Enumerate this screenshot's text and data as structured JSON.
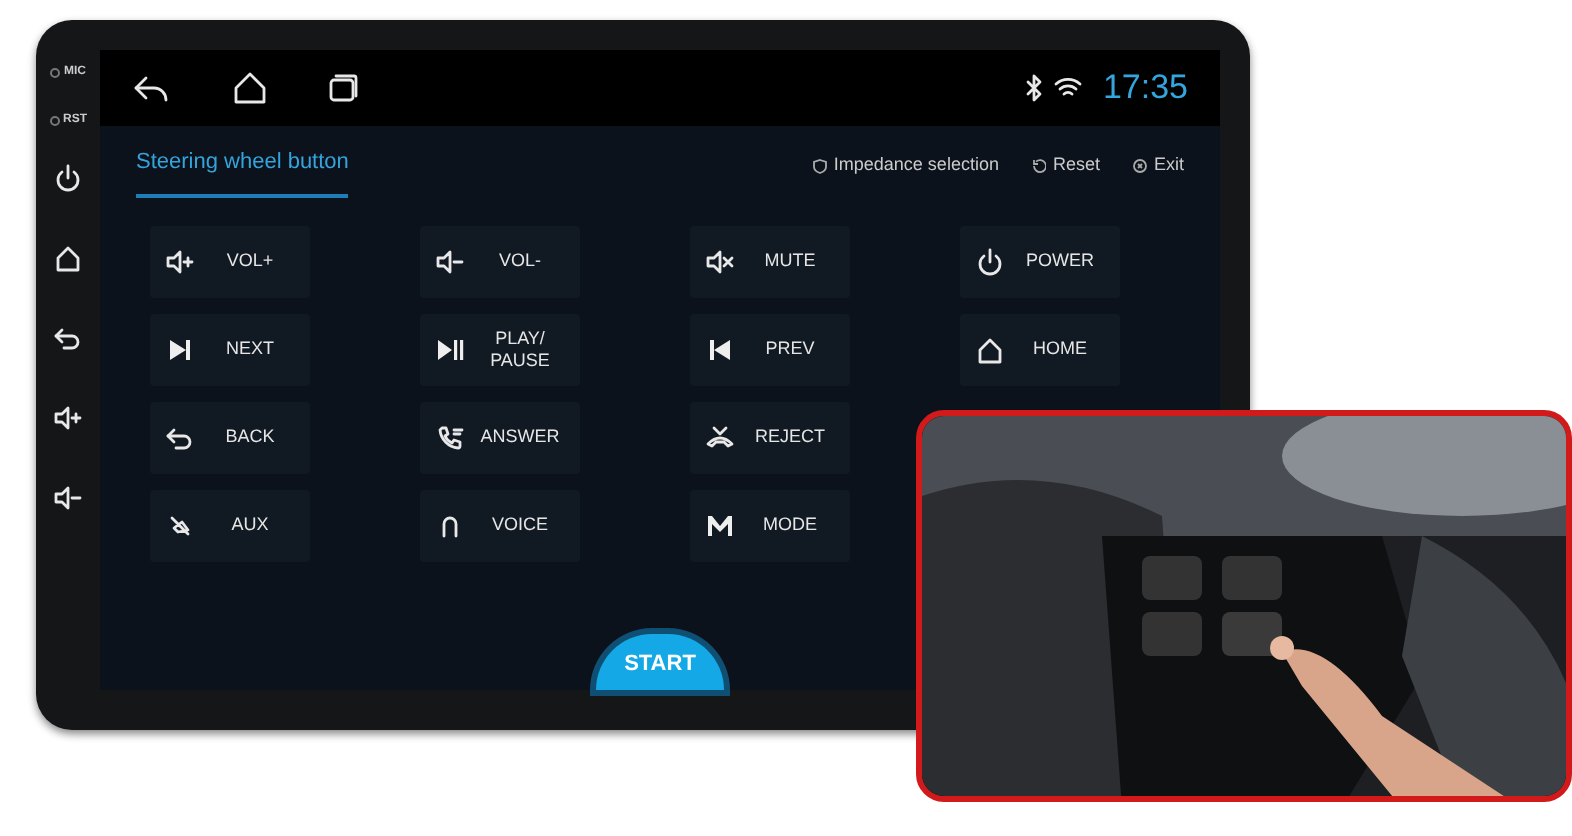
{
  "side_panel": {
    "labels": [
      "MIC",
      "RST"
    ]
  },
  "status_bar": {
    "time": "17:35"
  },
  "tab": {
    "label": "Steering wheel button",
    "selected": true
  },
  "actions": [
    "Impedance selection",
    "Reset",
    "Exit"
  ],
  "button_rows": [
    [
      {
        "label": "VOL+"
      },
      {
        "label": "VOL-"
      },
      {
        "label": "MUTE"
      },
      {
        "label": "POWER"
      }
    ],
    [
      {
        "label": "NEXT"
      },
      {
        "label": "PLAY/\nPAUSE"
      },
      {
        "label": "PREV"
      },
      {
        "label": "HOME"
      }
    ],
    [
      {
        "label": "BACK"
      },
      {
        "label": "ANSWER"
      },
      {
        "label": "REJECT"
      }
    ],
    [
      {
        "label": "AUX"
      },
      {
        "label": "VOICE"
      },
      {
        "label": "MODE"
      }
    ]
  ],
  "start_button": "START",
  "inset": {
    "kind": "picture"
  }
}
